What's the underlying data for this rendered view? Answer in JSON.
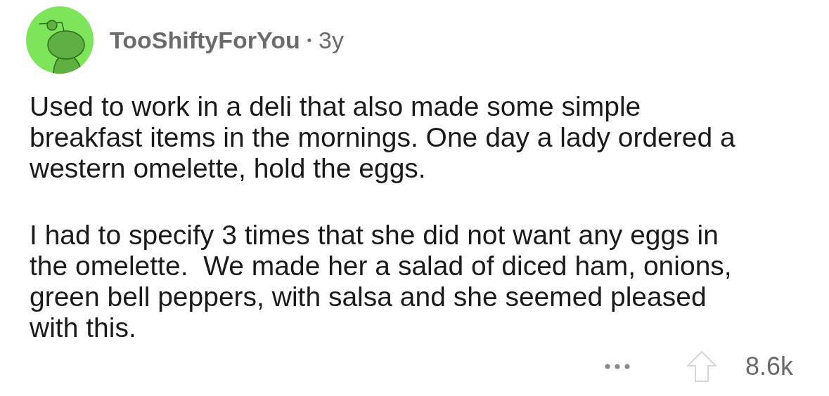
{
  "comment": {
    "author": "TooShiftyForYou",
    "separator": "•",
    "age": "3y",
    "paragraphs": [
      [
        "Used to work in a deli that also made some simple",
        "breakfast items in the mornings. One day a lady ordered a",
        "western omelette, hold the eggs."
      ],
      [
        "I had to specify 3 times that she did not want any eggs in",
        "the omelette.  We made her a salad of diced ham, onions,",
        "green bell peppers, with salsa and she seemed pleased",
        "with this."
      ]
    ],
    "score": "8.6k"
  }
}
